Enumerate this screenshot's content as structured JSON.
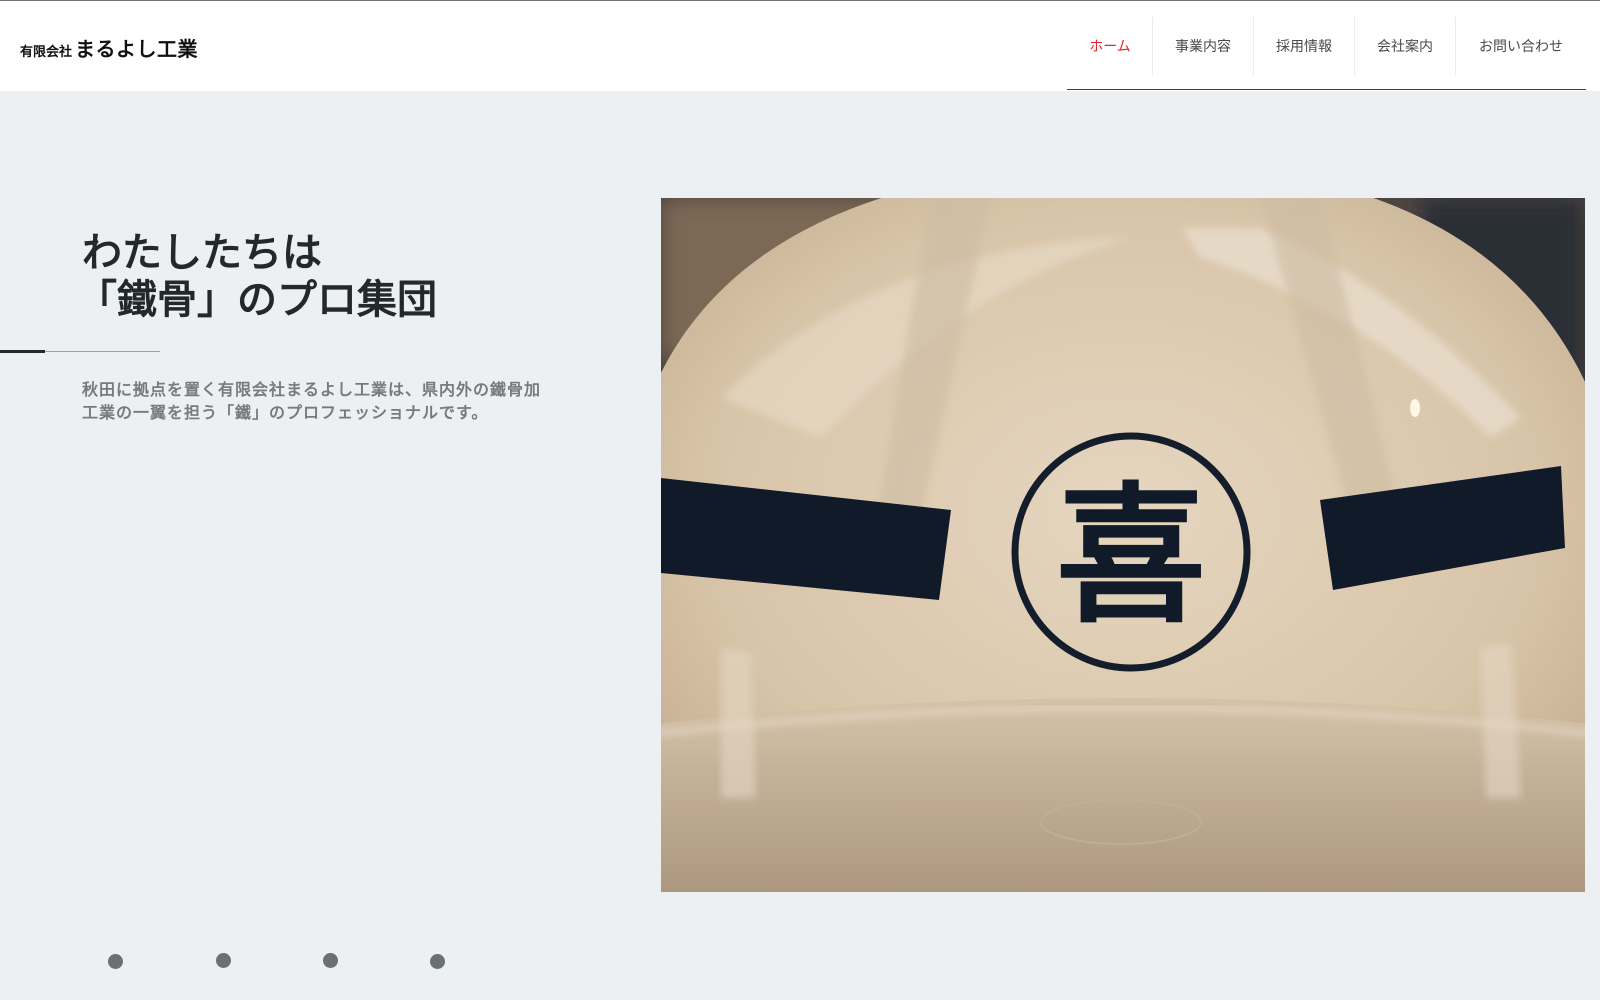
{
  "header": {
    "logo": {
      "prefix": "有限会社",
      "name": "まるよし工業"
    },
    "nav": [
      {
        "label": "ホーム",
        "active": true
      },
      {
        "label": "事業内容",
        "active": false
      },
      {
        "label": "採用情報",
        "active": false
      },
      {
        "label": "会社案内",
        "active": false
      },
      {
        "label": "お問い合わせ",
        "active": false
      }
    ]
  },
  "hero": {
    "title_line1": "わたしたちは",
    "title_line2": "「鐵骨」のプロ集団",
    "description": "秋田に拠点を置く有限会社まるよし工業は、県内外の鐵骨加工業の一翼を担う「鐵」のプロフェッショナルです。",
    "image": {
      "subject": "helmet-with-emblem",
      "emblem_text": "喜"
    }
  },
  "slider": {
    "dot_count": 4
  },
  "colors": {
    "background": "#ecf0f3",
    "header_bg": "#ffffff",
    "active_nav": "#e3262f",
    "text_dark": "#23292b",
    "text_muted": "#777b7e",
    "dot": "#6b7074"
  }
}
